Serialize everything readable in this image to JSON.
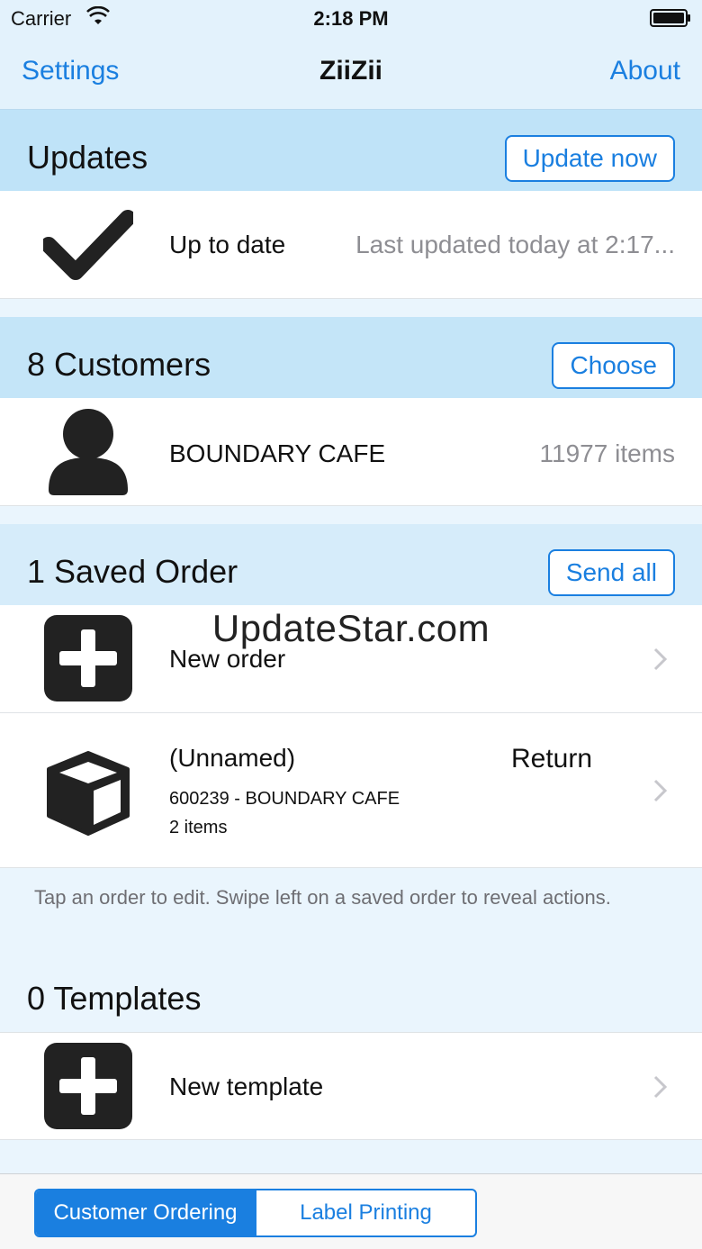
{
  "status_bar": {
    "carrier": "Carrier",
    "time": "2:18 PM"
  },
  "nav": {
    "left": "Settings",
    "title": "ZiiZii",
    "right": "About"
  },
  "updates": {
    "title": "Updates",
    "button": "Update now",
    "row": {
      "icon": "checkmark-icon",
      "label": "Up to date",
      "detail": "Last updated today at 2:17..."
    }
  },
  "customers": {
    "title": "8 Customers",
    "button": "Choose",
    "row": {
      "icon": "person-icon",
      "label": "BOUNDARY CAFE",
      "detail": "11977 items"
    }
  },
  "saved_orders": {
    "title": "1 Saved Order",
    "button": "Send all",
    "rows": [
      {
        "icon": "plus-square-icon",
        "label": "New order"
      },
      {
        "icon": "box-icon",
        "label": "(Unnamed)",
        "type": "Return",
        "customer": "600239 - BOUNDARY CAFE",
        "count": "2 items"
      }
    ],
    "note": "Tap an order to edit. Swipe left on a saved order to reveal actions."
  },
  "templates": {
    "title": "0 Templates",
    "rows": [
      {
        "icon": "plus-square-icon",
        "label": "New template"
      }
    ]
  },
  "watermark": "UpdateStar.com",
  "tabs": {
    "items": [
      "Customer Ordering",
      "Label Printing"
    ],
    "active": "Customer Ordering"
  },
  "colors": {
    "accent": "#1a7fe0",
    "header_bg": "#bfe3f8"
  }
}
